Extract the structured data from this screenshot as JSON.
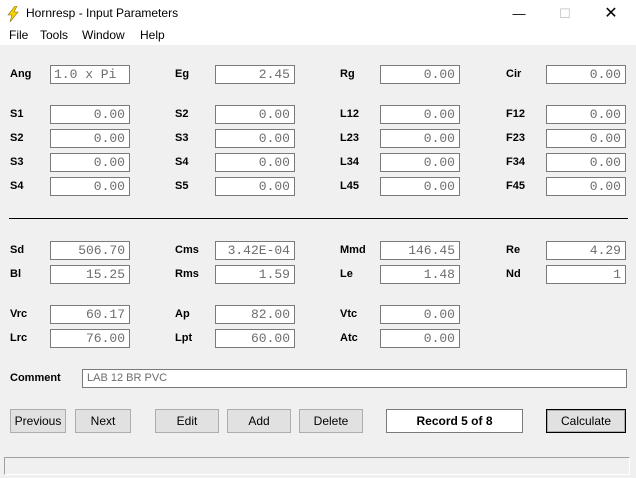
{
  "window": {
    "title": "Hornresp - Input Parameters",
    "minimize_glyph": "—",
    "maximize_glyph": "☐",
    "close_glyph": "✕"
  },
  "menu": {
    "file": "File",
    "tools": "Tools",
    "window": "Window",
    "help": "Help"
  },
  "params": {
    "ang": {
      "label": "Ang",
      "value": "1.0 x Pi"
    },
    "eg": {
      "label": "Eg",
      "value": "2.45"
    },
    "rg": {
      "label": "Rg",
      "value": "0.00"
    },
    "cir": {
      "label": "Cir",
      "value": "0.00"
    },
    "s1a": {
      "label": "S1",
      "value": "0.00"
    },
    "s2a": {
      "label": "S2",
      "value": "0.00"
    },
    "l12": {
      "label": "L12",
      "value": "0.00"
    },
    "f12": {
      "label": "F12",
      "value": "0.00"
    },
    "s2b": {
      "label": "S2",
      "value": "0.00"
    },
    "s3a": {
      "label": "S3",
      "value": "0.00"
    },
    "l23": {
      "label": "L23",
      "value": "0.00"
    },
    "f23": {
      "label": "F23",
      "value": "0.00"
    },
    "s3b": {
      "label": "S3",
      "value": "0.00"
    },
    "s4a": {
      "label": "S4",
      "value": "0.00"
    },
    "l34": {
      "label": "L34",
      "value": "0.00"
    },
    "f34": {
      "label": "F34",
      "value": "0.00"
    },
    "s4b": {
      "label": "S4",
      "value": "0.00"
    },
    "s5": {
      "label": "S5",
      "value": "0.00"
    },
    "l45": {
      "label": "L45",
      "value": "0.00"
    },
    "f45": {
      "label": "F45",
      "value": "0.00"
    },
    "sd": {
      "label": "Sd",
      "value": "506.70"
    },
    "cms": {
      "label": "Cms",
      "value": "3.42E-04"
    },
    "mmd": {
      "label": "Mmd",
      "value": "146.45"
    },
    "re": {
      "label": "Re",
      "value": "4.29"
    },
    "bl": {
      "label": "Bl",
      "value": "15.25"
    },
    "rms": {
      "label": "Rms",
      "value": "1.59"
    },
    "le": {
      "label": "Le",
      "value": "1.48"
    },
    "nd": {
      "label": "Nd",
      "value": "1"
    },
    "vrc": {
      "label": "Vrc",
      "value": "60.17"
    },
    "ap": {
      "label": "Ap",
      "value": "82.00"
    },
    "vtc": {
      "label": "Vtc",
      "value": "0.00"
    },
    "lrc": {
      "label": "Lrc",
      "value": "76.00"
    },
    "lpt": {
      "label": "Lpt",
      "value": "60.00"
    },
    "atc": {
      "label": "Atc",
      "value": "0.00"
    }
  },
  "comment": {
    "label": "Comment",
    "value": "LAB 12 BR PVC"
  },
  "buttons": {
    "previous": "Previous",
    "next": "Next",
    "edit": "Edit",
    "add": "Add",
    "delete": "Delete",
    "calculate": "Calculate"
  },
  "record": "Record 5 of 8",
  "colors": {
    "accent_icon": "#f5d200",
    "field_text": "#6d6d6d"
  }
}
